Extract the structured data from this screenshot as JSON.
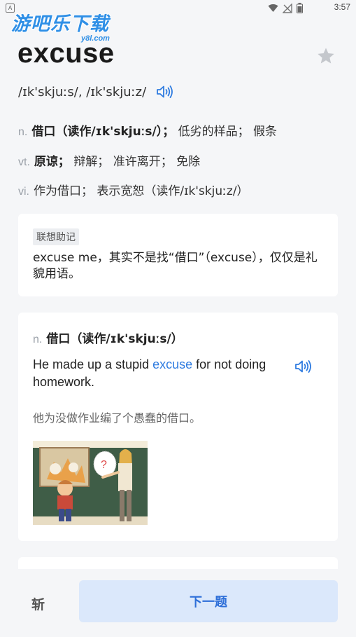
{
  "status_bar": {
    "time": "3:57",
    "left_badge": "A"
  },
  "watermark": {
    "main": "游吧乐下载",
    "sub": "y8l.com"
  },
  "word": {
    "headword": "excuse",
    "phonetic": "/ɪk'skjuːs/, /ɪk'skjuːz/"
  },
  "definitions": [
    {
      "pos": "n.",
      "bold": "借口（读作/ɪk'skjuːs/）；",
      "rest": " 低劣的样品； 假条"
    },
    {
      "pos": "vt.",
      "bold": "原谅；",
      "rest": " 辩解； 准许离开； 免除"
    },
    {
      "pos": "vi.",
      "bold": "",
      "rest": "作为借口； 表示宽恕（读作/ɪk'skjuːz/）"
    }
  ],
  "mnemonic": {
    "tag": "联想助记",
    "text": "excuse me，其实不是找“借口”（excuse），仅仅是礼貌用语。"
  },
  "example": {
    "pos": "n.",
    "sense": "借口（读作/ɪk'skjuːs/）",
    "en_before": "He made up a stupid ",
    "en_highlight": "excuse",
    "en_after": " for not doing homework.",
    "cn": "他为没做作业编了个愚蠢的借口。"
  },
  "bottom": {
    "chop_label": "斩",
    "next_label": "下一题"
  },
  "colors": {
    "accent": "#2e7be0",
    "button_bg": "#dbe8fb",
    "page_bg": "#f5f6f8"
  },
  "icons": [
    "star-icon",
    "speaker-icon",
    "wifi-icon",
    "signal-icon",
    "battery-icon"
  ]
}
